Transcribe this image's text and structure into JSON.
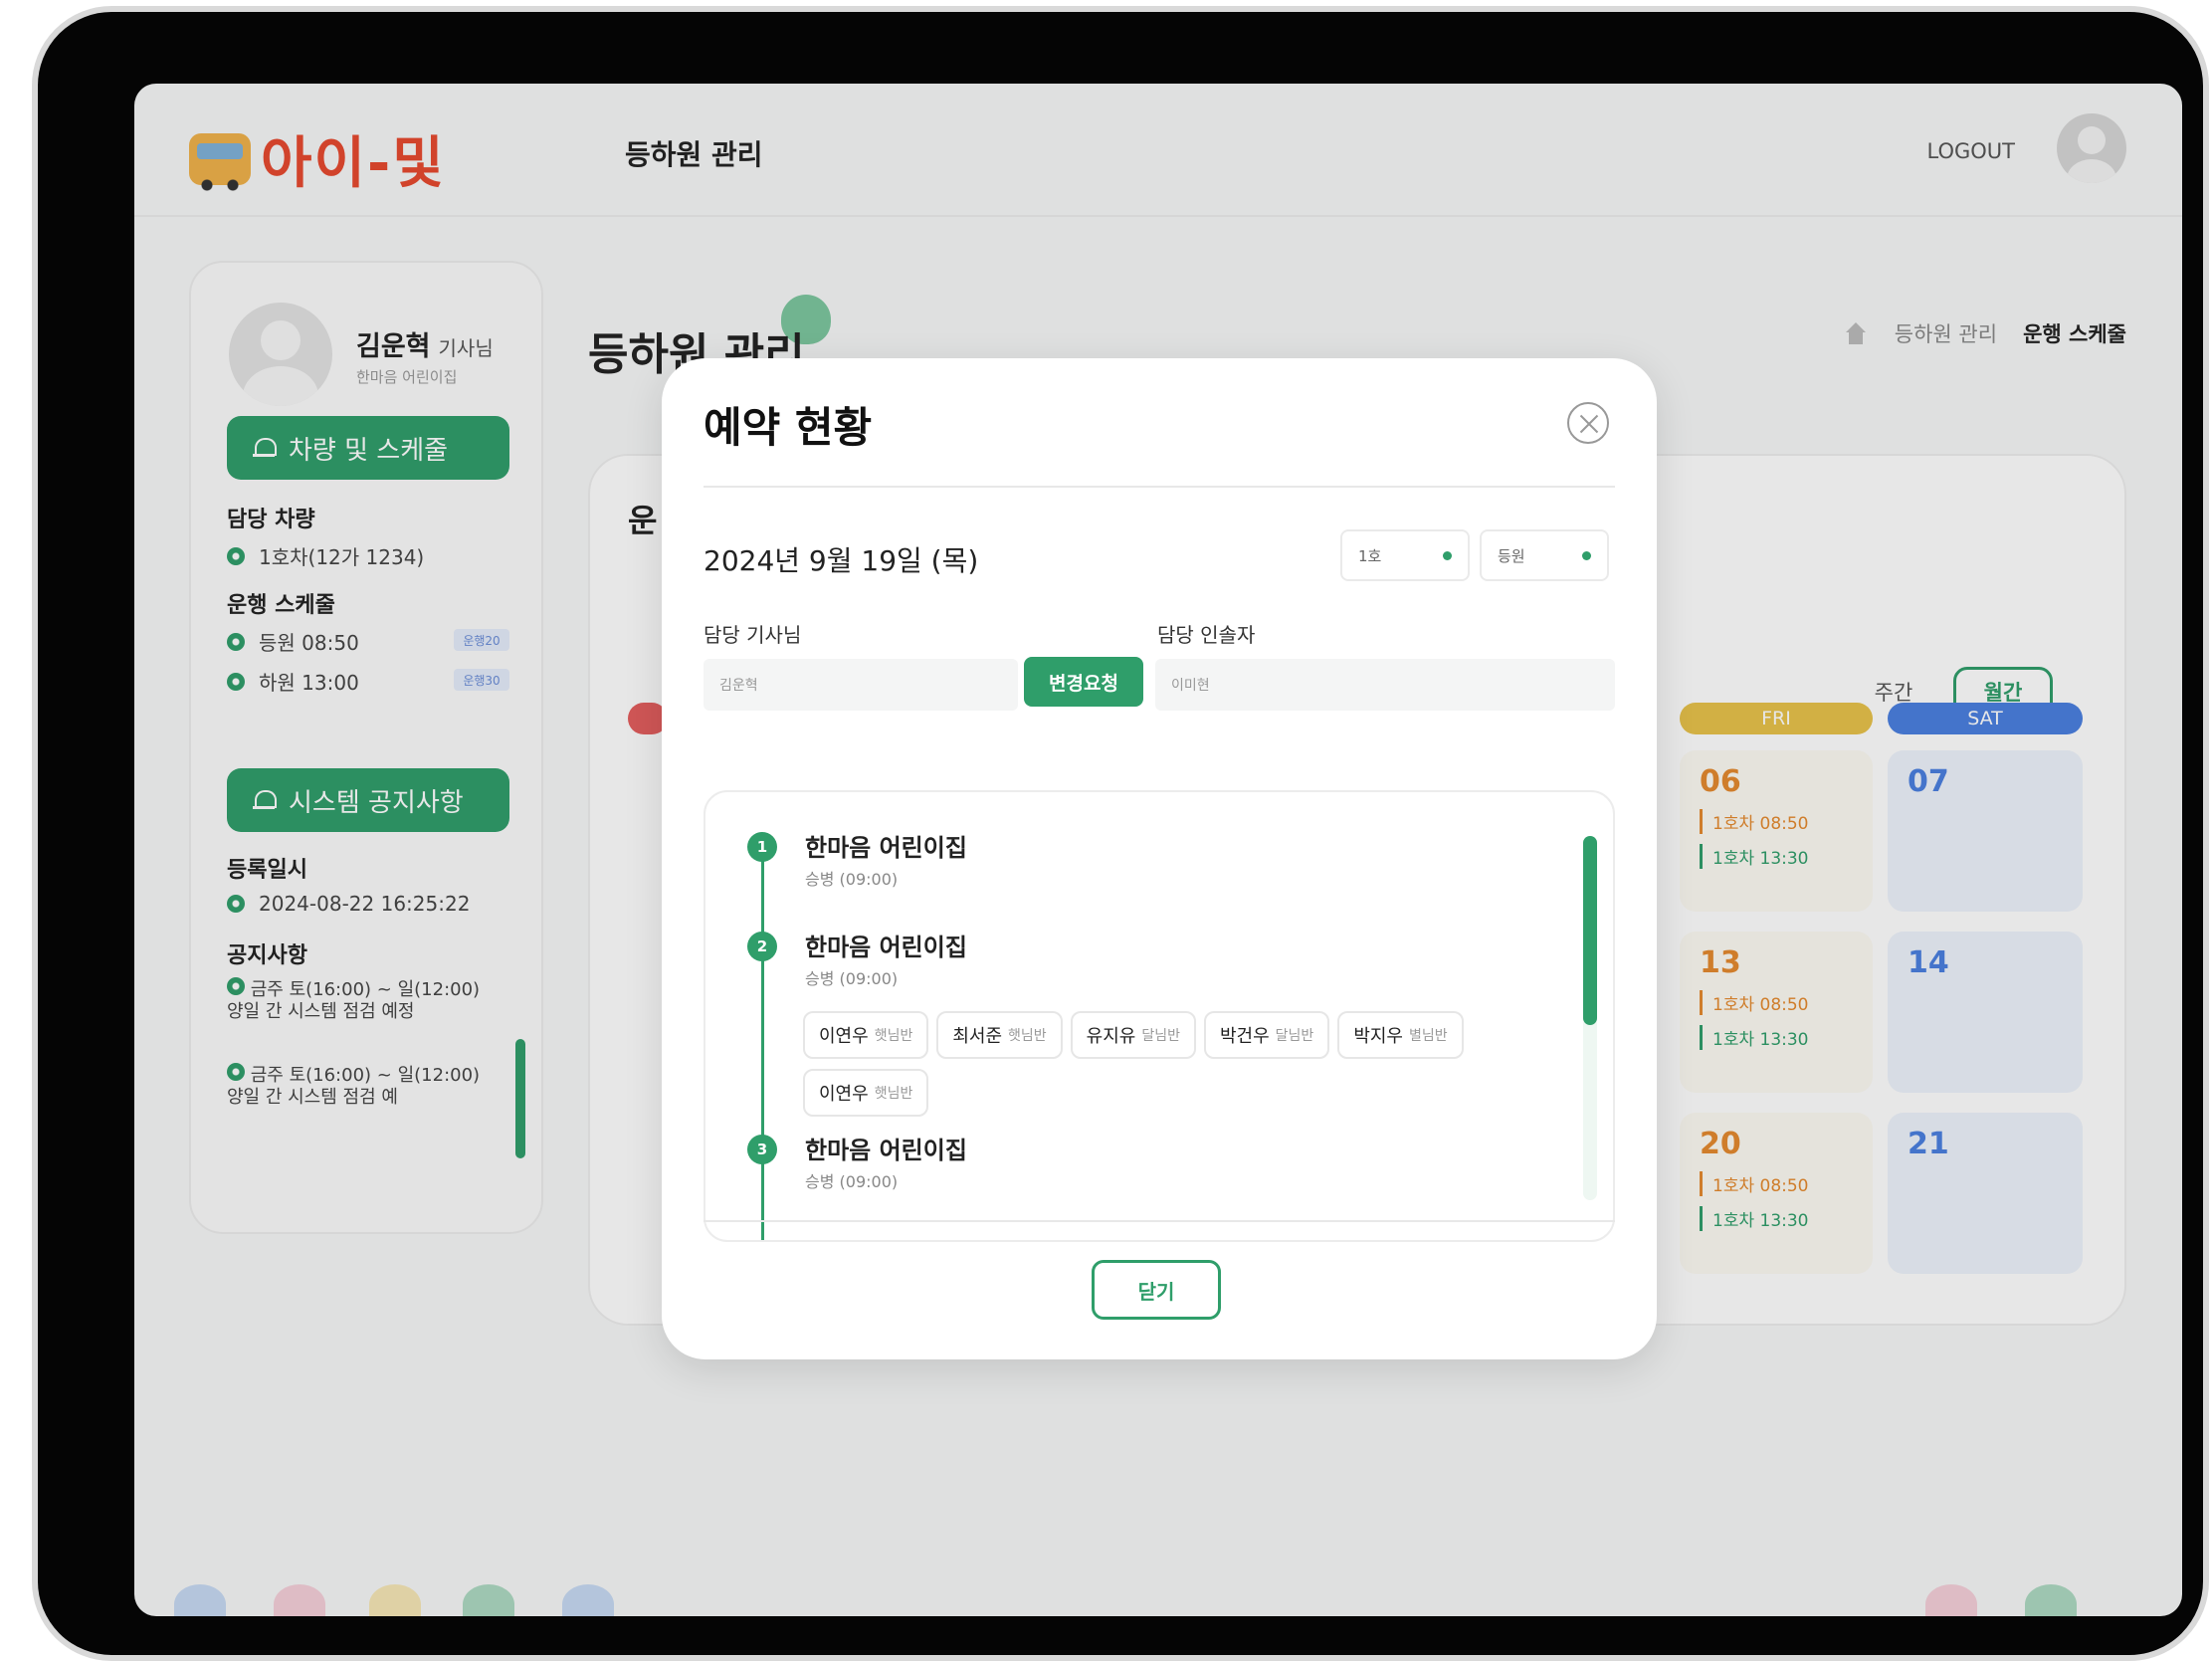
{
  "header": {
    "logo_text": "아이-및",
    "nav_item": "등하원 관리",
    "logout": "LOGOUT"
  },
  "sidebar": {
    "user_name": "김운혁",
    "user_role": "기사님",
    "user_org": "한마음 어린이집",
    "vehicle_button": "차량 및 스케줄",
    "vehicle_label": "담당 차량",
    "vehicle_value": "1호차(12가 1234)",
    "schedule_label": "운행 스케줄",
    "schedule": [
      {
        "label": "등원 08:50",
        "tag": "운행20"
      },
      {
        "label": "하원 13:00",
        "tag": "운행30"
      }
    ],
    "notice_button": "시스템 공지사항",
    "reg_label": "등록일시",
    "reg_value": "2024-08-22 16:25:22",
    "notice_label": "공지사항",
    "notices": [
      "금주 토(16:00) ~ 일(12:00) 양일 간 시스템 점검 예정",
      "금주 토(16:00) ~ 일(12:00) 양일 간 시스템 점검 예"
    ]
  },
  "main": {
    "page_title": "등하원 관리",
    "breadcrumb": [
      "등하원 관리",
      "운행 스케줄"
    ],
    "card_title_stub": "운",
    "view_week": "주간",
    "view_month": "월간",
    "day_heads": {
      "fri": "FRI",
      "sat": "SAT"
    },
    "calendar": [
      {
        "fri": "06",
        "sat": "07",
        "trips": [
          "1호차 08:50",
          "1호차 13:30"
        ]
      },
      {
        "fri": "13",
        "sat": "14",
        "trips": [
          "1호차 08:50",
          "1호차 13:30"
        ]
      },
      {
        "fri": "20",
        "sat": "21",
        "trips": [
          "1호차 08:50",
          "1호차 13:30"
        ]
      }
    ]
  },
  "modal": {
    "title": "예약 현황",
    "date": "2024년 9월 19일 (목)",
    "select_vehicle": "1호",
    "select_type": "등원",
    "driver_label": "담당 기사님",
    "driver_value": "김운혁",
    "change_button": "변경요청",
    "guardian_label": "담당 인솔자",
    "guardian_value": "이미현",
    "stops": [
      {
        "num": "1",
        "name": "한마음 어린이집",
        "time": "승병 (09:00)"
      },
      {
        "num": "2",
        "name": "한마음 어린이집",
        "time": "승병 (09:00)"
      },
      {
        "num": "3",
        "name": "한마음 어린이집",
        "time": "승병 (09:00)"
      }
    ],
    "children": [
      {
        "name": "이연우",
        "cls": "햇님반"
      },
      {
        "name": "최서준",
        "cls": "햇님반"
      },
      {
        "name": "유지유",
        "cls": "달님반"
      },
      {
        "name": "박건우",
        "cls": "달님반"
      },
      {
        "name": "박지우",
        "cls": "별님반"
      },
      {
        "name": "이연우",
        "cls": "햇님반"
      }
    ],
    "close_button": "닫기"
  },
  "colors": {
    "primary": "#2f9e6a",
    "friday": "#e8c24a",
    "saturday": "#4a7fe0",
    "trip_orange": "#e58a2e"
  }
}
